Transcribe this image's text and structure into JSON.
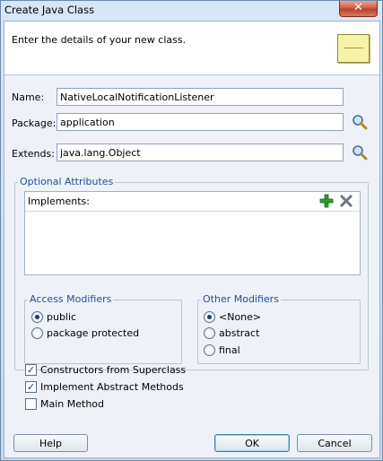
{
  "window": {
    "title": "Create Java Class",
    "close_label": "✕"
  },
  "header": {
    "instruction": "Enter the details of your new class."
  },
  "form": {
    "name_label": "Name:",
    "name_value": "NativeLocalNotificationListener",
    "package_label": "Package:",
    "package_value": "application",
    "extends_label": "Extends:",
    "extends_value": "java.lang.Object"
  },
  "optional": {
    "legend": "Optional Attributes",
    "implements_label": "Implements:",
    "add_icon": "plus-icon",
    "remove_icon": "x-icon"
  },
  "access": {
    "legend": "Access Modifiers",
    "options": [
      "public",
      "package protected"
    ],
    "selected": "public"
  },
  "other": {
    "legend": "Other Modifiers",
    "options": [
      "<None>",
      "abstract",
      "final"
    ],
    "selected": "<None>"
  },
  "checks": [
    {
      "label": "Constructors from Superclass",
      "checked": true
    },
    {
      "label": "Implement Abstract Methods",
      "checked": true
    },
    {
      "label": "Main Method",
      "checked": false
    }
  ],
  "buttons": {
    "help": "Help",
    "ok": "OK",
    "cancel": "Cancel"
  },
  "colors": {
    "legend": "#1f4f9a",
    "close": "#c8472b",
    "add": "#2aa02a"
  }
}
